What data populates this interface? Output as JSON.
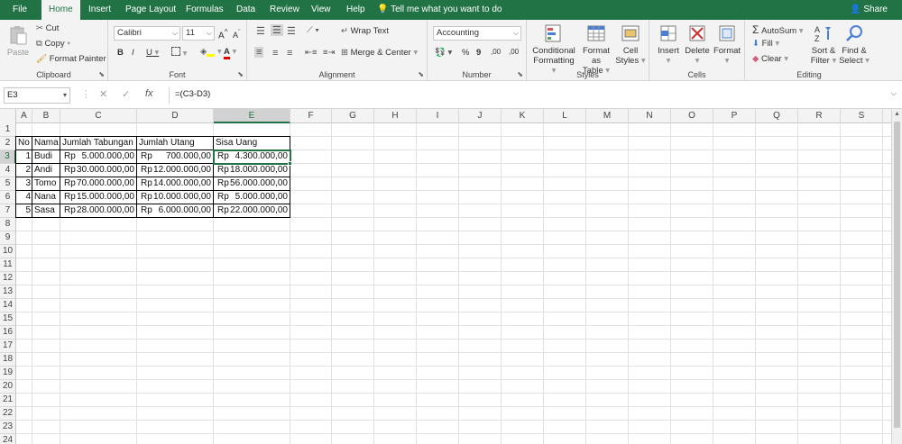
{
  "tabs": [
    "File",
    "Home",
    "Insert",
    "Page Layout",
    "Formulas",
    "Data",
    "Review",
    "View",
    "Help"
  ],
  "active_tab": "Home",
  "tell_me": "Tell me what you want to do",
  "share": "Share",
  "clipboard": {
    "paste": "Paste",
    "cut": "Cut",
    "copy": "Copy",
    "format_painter": "Format Painter",
    "label": "Clipboard"
  },
  "font": {
    "name": "Calibri",
    "size": "11",
    "label": "Font",
    "bold": "B",
    "italic": "I",
    "underline": "U",
    "grow": "A",
    "shrink": "A"
  },
  "alignment": {
    "wrap_text": "Wrap Text",
    "merge_center": "Merge & Center",
    "label": "Alignment"
  },
  "number": {
    "format": "Accounting",
    "label": "Number",
    "percent": "%",
    "comma": "9",
    "inc_decimal": ",00",
    "dec_decimal": ",00"
  },
  "styles": {
    "conditional_formatting": [
      "Conditional",
      "Formatting"
    ],
    "format_as_table": [
      "Format as",
      "Table"
    ],
    "cell_styles": [
      "Cell",
      "Styles"
    ],
    "label": "Styles"
  },
  "cells": {
    "insert": "Insert",
    "delete": "Delete",
    "format": "Format",
    "label": "Cells"
  },
  "editing": {
    "autosum": "AutoSum",
    "fill": "Fill",
    "clear": "Clear",
    "sort_filter": [
      "Sort &",
      "Filter"
    ],
    "find_select": [
      "Find &",
      "Select"
    ],
    "label": "Editing"
  },
  "formula_bar": {
    "name_box": "E3",
    "cancel": "✕",
    "enter": "✓",
    "fx": "fx",
    "formula": "=(C3-D3)"
  },
  "columns": [
    "A",
    "B",
    "C",
    "D",
    "E",
    "F",
    "G",
    "H",
    "I",
    "J",
    "K",
    "L",
    "M",
    "N",
    "O",
    "P",
    "Q",
    "R",
    "S"
  ],
  "rows": [
    "1",
    "2",
    "3",
    "4",
    "5",
    "6",
    "7",
    "8",
    "9",
    "10",
    "11",
    "12",
    "13",
    "14",
    "15",
    "16",
    "17",
    "18",
    "19",
    "20",
    "21",
    "22",
    "23",
    "24"
  ],
  "selected_cell": {
    "col": "E",
    "row": "3"
  },
  "table": {
    "headers": [
      "No",
      "Nama",
      "Jumlah Tabungan",
      "Jumlah Utang",
      "Sisa Uang"
    ],
    "rows": [
      {
        "no": "1",
        "nama": "Budi",
        "tabungan": "5.000.000,00",
        "utang": "700.000,00",
        "sisa": "4.300.000,00"
      },
      {
        "no": "2",
        "nama": "Andi",
        "tabungan": "30.000.000,00",
        "utang": "12.000.000,00",
        "sisa": "18.000.000,00"
      },
      {
        "no": "3",
        "nama": "Tomo",
        "tabungan": "70.000.000,00",
        "utang": "14.000.000,00",
        "sisa": "56.000.000,00"
      },
      {
        "no": "4",
        "nama": "Nana",
        "tabungan": "15.000.000,00",
        "utang": "10.000.000,00",
        "sisa": "5.000.000,00"
      },
      {
        "no": "5",
        "nama": "Sasa",
        "tabungan": "28.000.000,00",
        "utang": "6.000.000,00",
        "sisa": "22.000.000,00"
      }
    ],
    "currency": "Rp"
  },
  "colors": {
    "excel_green": "#217346",
    "ribbon_bg": "#f3f3f3"
  }
}
